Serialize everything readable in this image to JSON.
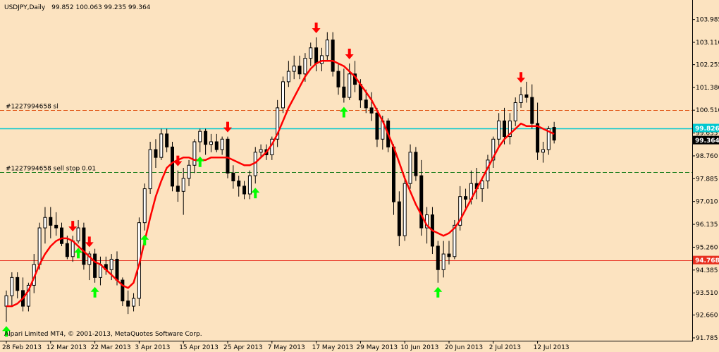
{
  "header": {
    "symbol": "USDJPY,Daily",
    "ohlc": "99.852 100.063 99.235 99.364"
  },
  "footer": {
    "copyright": "Alpari Limited MT4, © 2001-2013, MetaQuotes Software Corp."
  },
  "colors": {
    "background": "#fce3c0",
    "bull_candle": "#ffffff",
    "bear_candle": "#000000",
    "ma_line": "#ff0000",
    "buy_arrow": "#00ff00",
    "sell_arrow": "#ff0000",
    "cyan_line": "#00c8d0",
    "red_line": "#e83020",
    "sl_line": "#e05010",
    "order_line": "#208020"
  },
  "chart_data": {
    "type": "candlestick",
    "ylim": [
      91.785,
      104.3
    ],
    "y_ticks": [
      "103.985",
      "103.110",
      "102.255",
      "101.380",
      "100.510",
      "99.635",
      "98.760",
      "97.885",
      "97.010",
      "96.135",
      "95.260",
      "94.385",
      "93.510",
      "92.660",
      "91.785"
    ],
    "x_ticks": [
      {
        "label": "28 Feb 2013",
        "bar": 0
      },
      {
        "label": "12 Mar 2013",
        "bar": 8
      },
      {
        "label": "22 Mar 2013",
        "bar": 16
      },
      {
        "label": "3 Apr 2013",
        "bar": 24
      },
      {
        "label": "15 Apr 2013",
        "bar": 32
      },
      {
        "label": "25 Apr 2013",
        "bar": 40
      },
      {
        "label": "7 May 2013",
        "bar": 48
      },
      {
        "label": "17 May 2013",
        "bar": 56
      },
      {
        "label": "29 May 2013",
        "bar": 64
      },
      {
        "label": "10 Jun 2013",
        "bar": 72
      },
      {
        "label": "20 Jun 2013",
        "bar": 80
      },
      {
        "label": "2 Jul 2013",
        "bar": 88
      },
      {
        "label": "12 Jul 2013",
        "bar": 96
      }
    ],
    "hlines": [
      {
        "label": "#1227994658 sl",
        "value": 100.51,
        "style": "sl"
      },
      {
        "value": 99.826,
        "style": "cyan",
        "tag": "99.826"
      },
      {
        "label": "#1227994658 sell stop 0.01",
        "value": 98.15,
        "style": "order"
      },
      {
        "value": 94.768,
        "style": "red",
        "tag": "94.768"
      }
    ],
    "last_price_tag": "99.364",
    "bars": [
      [
        93.0,
        93.6,
        92.4,
        93.4
      ],
      [
        93.4,
        94.3,
        93.0,
        94.1
      ],
      [
        94.1,
        94.3,
        93.3,
        93.6
      ],
      [
        93.6,
        94.1,
        92.8,
        93.0
      ],
      [
        93.0,
        93.9,
        92.8,
        93.8
      ],
      [
        93.8,
        95.0,
        93.5,
        94.6
      ],
      [
        94.6,
        96.2,
        94.4,
        96.0
      ],
      [
        96.0,
        96.8,
        95.4,
        96.4
      ],
      [
        96.4,
        96.8,
        95.6,
        96.1
      ],
      [
        96.1,
        96.6,
        95.7,
        96.0
      ],
      [
        96.0,
        96.2,
        95.3,
        95.4
      ],
      [
        95.4,
        95.7,
        94.8,
        94.9
      ],
      [
        94.9,
        95.7,
        94.7,
        95.5
      ],
      [
        95.5,
        96.3,
        95.4,
        96.0
      ],
      [
        96.0,
        96.2,
        94.4,
        94.6
      ],
      [
        94.6,
        95.1,
        94.0,
        95.0
      ],
      [
        95.0,
        95.2,
        93.9,
        94.1
      ],
      [
        94.1,
        94.9,
        93.8,
        94.6
      ],
      [
        94.6,
        94.9,
        94.2,
        94.4
      ],
      [
        94.4,
        95.0,
        94.0,
        94.8
      ],
      [
        94.8,
        95.1,
        93.8,
        94.0
      ],
      [
        94.0,
        94.1,
        93.0,
        93.2
      ],
      [
        93.2,
        93.6,
        92.7,
        93.0
      ],
      [
        93.0,
        93.5,
        92.8,
        93.3
      ],
      [
        93.3,
        96.4,
        93.0,
        96.2
      ],
      [
        96.2,
        97.7,
        95.9,
        97.5
      ],
      [
        97.5,
        99.3,
        97.3,
        99.0
      ],
      [
        99.0,
        99.4,
        98.3,
        98.7
      ],
      [
        98.7,
        99.8,
        98.6,
        99.6
      ],
      [
        99.6,
        99.8,
        98.9,
        99.1
      ],
      [
        99.1,
        99.3,
        97.4,
        97.6
      ],
      [
        97.6,
        98.2,
        97.0,
        97.4
      ],
      [
        97.4,
        98.3,
        96.5,
        97.9
      ],
      [
        97.9,
        98.6,
        97.6,
        98.4
      ],
      [
        98.4,
        99.4,
        98.1,
        99.3
      ],
      [
        99.3,
        99.8,
        98.9,
        99.7
      ],
      [
        99.7,
        99.8,
        98.8,
        99.2
      ],
      [
        99.2,
        99.6,
        98.9,
        99.3
      ],
      [
        99.3,
        99.6,
        98.9,
        99.0
      ],
      [
        99.0,
        99.5,
        98.8,
        99.4
      ],
      [
        99.4,
        99.5,
        97.9,
        98.1
      ],
      [
        98.1,
        98.4,
        97.5,
        97.8
      ],
      [
        97.8,
        98.0,
        97.2,
        97.6
      ],
      [
        97.6,
        97.8,
        97.1,
        97.3
      ],
      [
        97.3,
        98.2,
        97.1,
        98.0
      ],
      [
        98.0,
        99.1,
        97.7,
        98.9
      ],
      [
        98.9,
        99.2,
        98.7,
        99.0
      ],
      [
        99.0,
        99.2,
        98.6,
        98.8
      ],
      [
        98.8,
        99.5,
        98.6,
        99.4
      ],
      [
        99.4,
        100.9,
        99.1,
        100.6
      ],
      [
        100.6,
        101.8,
        100.4,
        101.6
      ],
      [
        101.6,
        102.4,
        101.4,
        102.0
      ],
      [
        102.0,
        102.6,
        101.7,
        102.2
      ],
      [
        102.2,
        102.6,
        101.7,
        101.9
      ],
      [
        101.9,
        102.7,
        101.6,
        102.5
      ],
      [
        102.5,
        103.1,
        102.2,
        102.9
      ],
      [
        102.9,
        103.3,
        102.0,
        102.3
      ],
      [
        102.3,
        102.9,
        102.0,
        102.6
      ],
      [
        102.6,
        103.5,
        102.4,
        103.2
      ],
      [
        103.2,
        103.5,
        101.8,
        102.0
      ],
      [
        102.0,
        102.3,
        101.1,
        101.4
      ],
      [
        101.4,
        102.1,
        100.8,
        101.0
      ],
      [
        101.0,
        102.3,
        100.9,
        101.9
      ],
      [
        101.9,
        102.4,
        101.2,
        101.5
      ],
      [
        101.5,
        101.7,
        100.6,
        100.9
      ],
      [
        100.9,
        101.3,
        100.4,
        100.6
      ],
      [
        100.6,
        101.2,
        100.1,
        100.4
      ],
      [
        100.4,
        100.6,
        99.1,
        99.4
      ],
      [
        99.4,
        100.3,
        99.0,
        100.1
      ],
      [
        100.1,
        100.2,
        98.9,
        99.1
      ],
      [
        99.1,
        99.2,
        96.5,
        97.0
      ],
      [
        97.0,
        97.4,
        95.3,
        95.7
      ],
      [
        95.7,
        98.0,
        95.5,
        97.7
      ],
      [
        97.7,
        99.2,
        97.5,
        98.9
      ],
      [
        98.9,
        99.1,
        97.8,
        98.0
      ],
      [
        98.0,
        98.6,
        95.7,
        96.0
      ],
      [
        96.0,
        96.8,
        95.4,
        96.5
      ],
      [
        96.5,
        96.8,
        95.0,
        95.3
      ],
      [
        95.3,
        95.5,
        93.9,
        94.4
      ],
      [
        94.4,
        95.5,
        94.1,
        95.0
      ],
      [
        95.0,
        95.5,
        94.6,
        94.9
      ],
      [
        94.9,
        96.3,
        94.8,
        96.1
      ],
      [
        96.1,
        97.6,
        95.9,
        97.2
      ],
      [
        97.2,
        97.5,
        96.7,
        97.1
      ],
      [
        97.1,
        98.2,
        96.9,
        97.7
      ],
      [
        97.7,
        98.3,
        97.1,
        97.5
      ],
      [
        97.5,
        97.9,
        97.0,
        97.8
      ],
      [
        97.8,
        98.8,
        97.5,
        98.6
      ],
      [
        98.6,
        99.5,
        98.3,
        99.4
      ],
      [
        99.4,
        100.4,
        99.1,
        100.1
      ],
      [
        100.1,
        100.6,
        99.2,
        99.5
      ],
      [
        99.5,
        100.4,
        99.2,
        100.1
      ],
      [
        100.1,
        101.0,
        99.9,
        100.8
      ],
      [
        100.8,
        101.4,
        100.6,
        101.1
      ],
      [
        101.1,
        101.6,
        100.8,
        101.0
      ],
      [
        101.0,
        101.5,
        99.8,
        100.0
      ],
      [
        100.0,
        100.8,
        98.6,
        98.9
      ],
      [
        98.9,
        99.3,
        98.5,
        99.0
      ],
      [
        99.0,
        99.9,
        98.8,
        99.8
      ],
      [
        99.852,
        100.063,
        99.235,
        99.364
      ]
    ],
    "ma_series": [
      93.0,
      93.0,
      93.1,
      93.3,
      93.6,
      94.1,
      94.6,
      95.0,
      95.3,
      95.5,
      95.6,
      95.6,
      95.5,
      95.3,
      95.1,
      94.9,
      94.7,
      94.6,
      94.4,
      94.2,
      94.0,
      93.8,
      93.7,
      93.9,
      94.6,
      95.5,
      96.4,
      97.2,
      97.8,
      98.3,
      98.5,
      98.6,
      98.7,
      98.7,
      98.6,
      98.6,
      98.6,
      98.7,
      98.7,
      98.7,
      98.7,
      98.6,
      98.5,
      98.4,
      98.4,
      98.5,
      98.7,
      98.9,
      99.2,
      99.6,
      100.1,
      100.6,
      101.0,
      101.4,
      101.8,
      102.1,
      102.3,
      102.4,
      102.4,
      102.4,
      102.3,
      102.2,
      102.0,
      101.8,
      101.5,
      101.2,
      100.9,
      100.5,
      100.1,
      99.6,
      99.1,
      98.5,
      97.9,
      97.4,
      96.9,
      96.5,
      96.1,
      95.9,
      95.8,
      95.7,
      95.8,
      96.0,
      96.3,
      96.7,
      97.1,
      97.5,
      97.9,
      98.3,
      98.7,
      99.1,
      99.4,
      99.6,
      99.8,
      100.0,
      99.9,
      99.9,
      99.9,
      99.8,
      99.7,
      99.6
    ],
    "arrows": [
      {
        "bar": 0,
        "dir": "up"
      },
      {
        "bar": 12,
        "dir": "down"
      },
      {
        "bar": 13,
        "dir": "up"
      },
      {
        "bar": 15,
        "dir": "down"
      },
      {
        "bar": 16,
        "dir": "up"
      },
      {
        "bar": 25,
        "dir": "up"
      },
      {
        "bar": 31,
        "dir": "down"
      },
      {
        "bar": 35,
        "dir": "up"
      },
      {
        "bar": 40,
        "dir": "down"
      },
      {
        "bar": 45,
        "dir": "up"
      },
      {
        "bar": 56,
        "dir": "down"
      },
      {
        "bar": 61,
        "dir": "up"
      },
      {
        "bar": 62,
        "dir": "down"
      },
      {
        "bar": 78,
        "dir": "up"
      },
      {
        "bar": 93,
        "dir": "down"
      }
    ]
  }
}
